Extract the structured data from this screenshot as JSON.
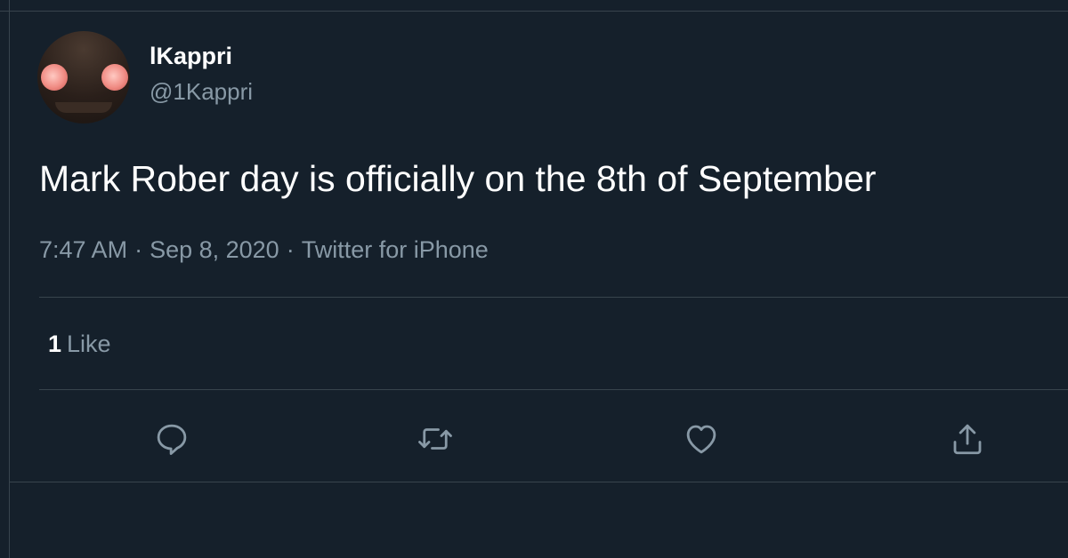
{
  "user": {
    "display_name": "lKappri",
    "handle": "@1Kappri",
    "avatar_icon": "robot-avatar"
  },
  "tweet": {
    "text": "Mark Rober day is officially on the 8th of September",
    "time": "7:47 AM",
    "separator": "·",
    "date": "Sep 8, 2020",
    "source": "Twitter for iPhone"
  },
  "stats": {
    "like_count": "1",
    "like_label": "Like"
  },
  "actions": {
    "reply_icon": "reply-icon",
    "retweet_icon": "retweet-icon",
    "like_icon": "heart-icon",
    "share_icon": "share-icon"
  },
  "colors": {
    "background": "#15202b",
    "text_primary": "#ffffff",
    "text_secondary": "#8899a6",
    "divider": "#38444d"
  }
}
